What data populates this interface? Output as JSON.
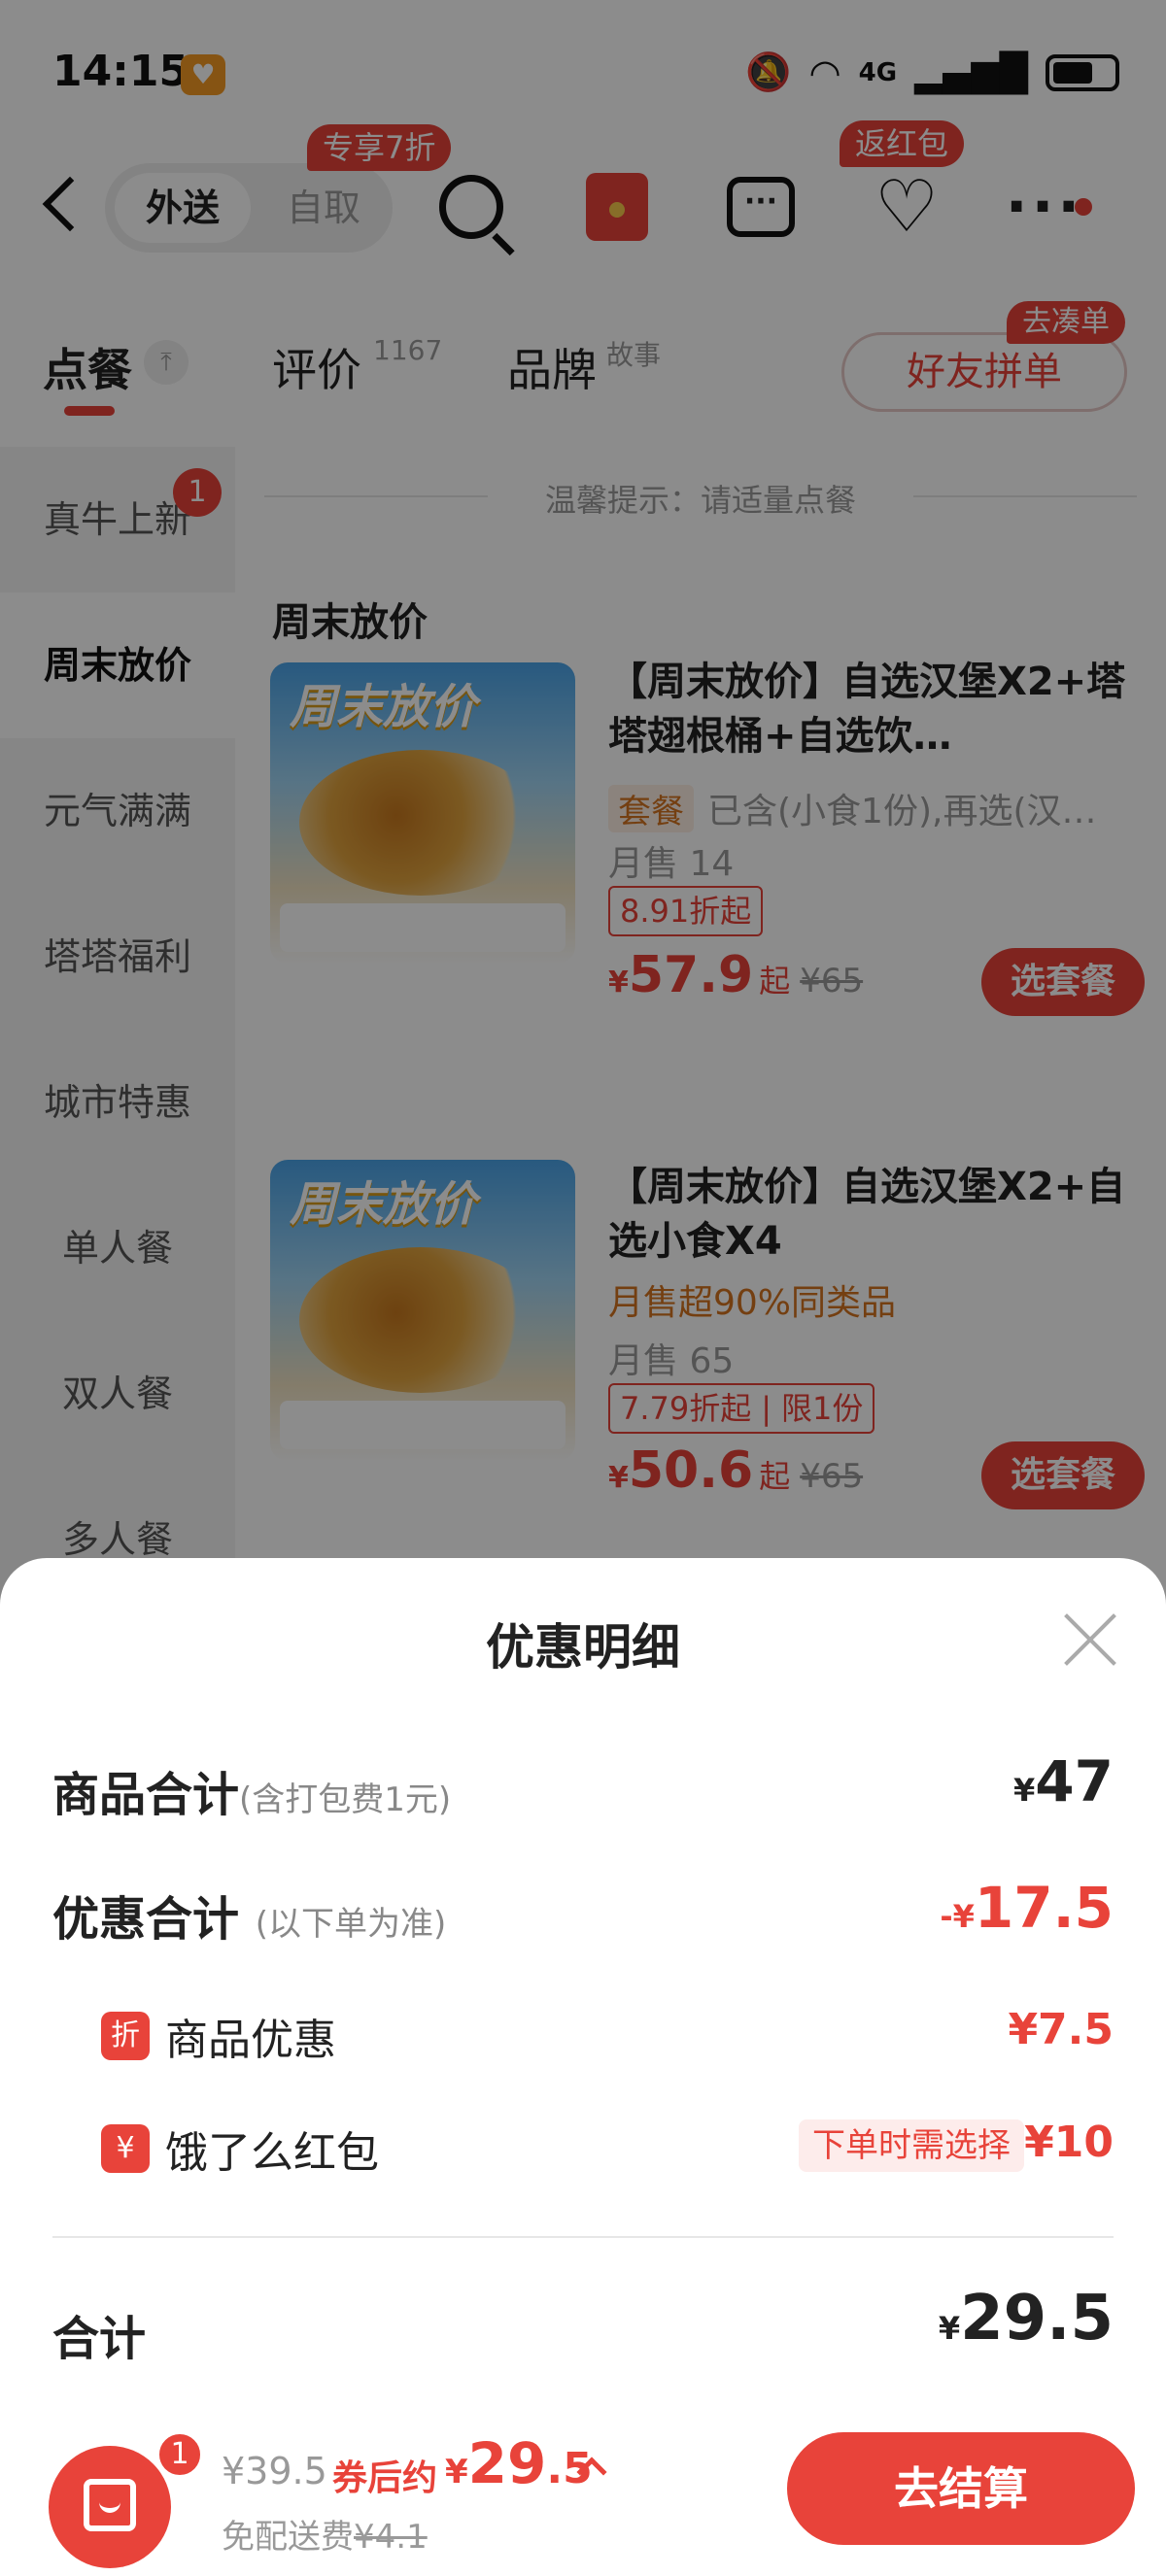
{
  "status_bar": {
    "time": "14:15",
    "network": "4G"
  },
  "nav": {
    "mode_active": "外送",
    "mode_inactive": "自取",
    "mode_tag": "专享7折",
    "hongbao_tag": "返红包"
  },
  "tabs": {
    "order": "点餐",
    "reviews": "评价",
    "reviews_count": "1167",
    "brand": "品牌",
    "brand_sup": "故事",
    "group_button": "好友拼单",
    "group_tag": "去凑单"
  },
  "sidebar": {
    "items": [
      {
        "label": "真牛上新",
        "badge": "1"
      },
      {
        "label": "周末放价"
      },
      {
        "label": "元气满满"
      },
      {
        "label": "塔塔福利"
      },
      {
        "label": "城市特惠"
      },
      {
        "label": "单人餐"
      },
      {
        "label": "双人餐"
      },
      {
        "label": "多人餐"
      }
    ]
  },
  "content": {
    "tip": "温馨提示：请适量点餐",
    "section_title": "周末放价",
    "products": [
      {
        "thumb_title": "周末放价",
        "name": "【周末放价】自选汉堡X2+塔塔翅根桶+自选饮…",
        "tag": "套餐",
        "desc": "已含(小食1份),再选(汉…",
        "sales": "月售 14",
        "discount": "8.91折起",
        "yen": "¥",
        "price": "57.9",
        "qi": "起",
        "orig": "¥65",
        "button": "选套餐"
      },
      {
        "thumb_title": "周末放价",
        "name": "【周末放价】自选汉堡X2+自选小食X4",
        "highlight": "月售超90%同类品",
        "sales": "月售 65",
        "discount": "7.79折起",
        "limit": "限1份",
        "yen": "¥",
        "price": "50.6",
        "qi": "起",
        "orig": "¥65",
        "button": "选套餐"
      }
    ]
  },
  "sheet": {
    "title": "优惠明细",
    "goods_total_label": "商品合计",
    "goods_total_sub": "(含打包费1元)",
    "goods_total_yen": "¥",
    "goods_total_value": "47",
    "discount_total_label": "优惠合计",
    "discount_total_sub": "(以下单为准)",
    "discount_total_prefix": "-¥",
    "discount_total_value": "17.5",
    "item_discount_icon": "折",
    "item_discount_label": "商品优惠",
    "item_discount_value": "¥7.5",
    "hongbao_icon": "¥",
    "hongbao_label": "饿了么红包",
    "hongbao_note": "下单时需选择",
    "hongbao_value": "¥10",
    "total_label": "合计",
    "total_yen": "¥",
    "total_value": "29.5"
  },
  "bottom_bar": {
    "cart_badge": "1",
    "original": "¥39.5",
    "after_label": "券后约",
    "after_yen": "¥",
    "after_int": "29",
    "after_dec": ".5",
    "fee_label": "免配送费",
    "fee_strike": "¥4.1",
    "checkout": "去结算"
  },
  "colors": {
    "accent": "#e8433a",
    "overlay": "rgba(0,0,0,0.45)"
  }
}
